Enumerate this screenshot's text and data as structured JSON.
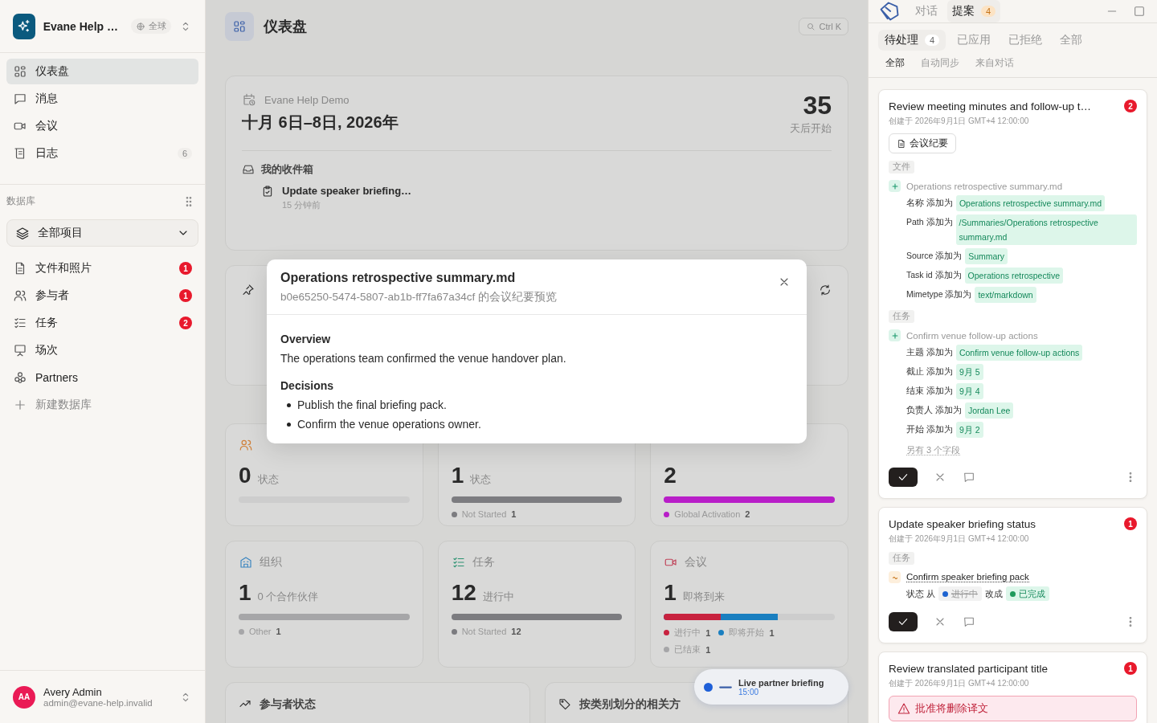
{
  "sidebar": {
    "workspace": {
      "name": "Evane Help …",
      "scope": "全球"
    },
    "nav": [
      {
        "label": "仪表盘",
        "selected": true
      },
      {
        "label": "消息",
        "selected": false
      },
      {
        "label": "会议",
        "selected": false
      },
      {
        "label": "日志",
        "selected": false,
        "count": "6"
      }
    ],
    "section_title": "数据库",
    "database_picker": {
      "label": "全部项目"
    },
    "databases": [
      {
        "label": "文件和照片",
        "badge": "1",
        "selected": false
      },
      {
        "label": "参与者",
        "badge": "1",
        "selected": false
      },
      {
        "label": "任务",
        "badge": "2",
        "selected": false
      },
      {
        "label": "场次",
        "selected": false
      },
      {
        "label": "Partners",
        "selected": false
      }
    ],
    "new_database": "新建数据库",
    "user": {
      "initials": "AA",
      "name": "Avery Admin",
      "email": "admin@evane-help.invalid"
    }
  },
  "header": {
    "title": "仪表盘",
    "shortcut": "Ctrl K"
  },
  "event_card": {
    "name": "Evane Help Demo",
    "dates": "十月 6日–8日, 2026年",
    "countdown": "35",
    "countdown_label": "天后开始",
    "inbox_title": "我的收件箱",
    "inbox_items": [
      {
        "title": "Update speaker briefing…",
        "time": "15 分钟前"
      }
    ]
  },
  "stat_cards": [
    {
      "value": "0",
      "caption": "状态"
    },
    {
      "value": "1",
      "caption": "状态",
      "segments": [
        {
          "color": "#7c7c80",
          "level": 1
        }
      ],
      "legend": [
        {
          "label": "Not Started",
          "count": "1",
          "color": "#7c7c80"
        }
      ]
    },
    {
      "value": "2",
      "segments": [
        {
          "color": "#b81ec8",
          "level": 1
        }
      ],
      "legend": [
        {
          "label": "Global Activation",
          "count": "2",
          "color": "#b81ec8"
        }
      ]
    },
    {
      "title": "组织",
      "value": "1",
      "caption": "0 个合作伙伴",
      "segments": [
        {
          "color": "#a6a6a8",
          "level": 1
        }
      ],
      "legend": [
        {
          "label": "Other",
          "count": "1",
          "color": "#a6a6a8"
        }
      ]
    },
    {
      "title": "任务",
      "value": "12",
      "caption": "进行中",
      "segments": [
        {
          "color": "#7c7c80",
          "level": 1
        }
      ],
      "legend": [
        {
          "label": "Not Started",
          "count": "12",
          "color": "#7c7c80"
        }
      ]
    },
    {
      "title": "会议",
      "value": "1",
      "caption": "即将到来",
      "segments": [
        {
          "color": "#c8223f",
          "level": 0.333
        },
        {
          "color": "#1a7fc0",
          "level": 0.667
        }
      ],
      "legend": [
        {
          "label": "进行中",
          "count": "1",
          "color": "#c8223f"
        },
        {
          "label": "即将开始",
          "count": "1",
          "color": "#1a7fc0"
        },
        {
          "label": "已结束",
          "count": "1",
          "color": "#a6a6a8"
        }
      ]
    }
  ],
  "panels": [
    {
      "title": "参与者状态"
    },
    {
      "title": "按类别划分的相关方"
    }
  ],
  "toast": {
    "title": "Live partner briefing",
    "time": "15:00"
  },
  "modal": {
    "title": "Operations retrospective summary.md",
    "subtitle": "b0e65250-5474-5807-ab1b-ff7fa67a34cf 的会议纪要预览",
    "sections": [
      {
        "heading": "Overview",
        "paragraph": "The operations team confirmed the venue handover plan."
      },
      {
        "heading": "Decisions",
        "bullets": [
          "Publish the final briefing pack.",
          "Confirm the venue operations owner."
        ]
      }
    ]
  },
  "assistant": {
    "tabs": [
      {
        "label": "对话",
        "selected": false
      },
      {
        "label": "提案",
        "selected": true,
        "count": "4"
      }
    ],
    "status_filters": [
      {
        "label": "待处理",
        "count": "4",
        "selected": true
      },
      {
        "label": "已应用",
        "selected": false
      },
      {
        "label": "已拒绝",
        "selected": false
      },
      {
        "label": "全部",
        "selected": false
      }
    ],
    "source_filters": [
      {
        "label": "全部",
        "selected": true
      },
      {
        "label": "自动同步",
        "selected": false
      },
      {
        "label": "来自对话",
        "selected": false
      }
    ],
    "proposals": [
      {
        "title": "Review meeting minutes and follow-up t…",
        "badge": "2",
        "created": "创建于 2026年9月1日 GMT+4 12:00:00",
        "source_chip": "会议纪要",
        "actions": true,
        "groups": [
          {
            "label": "文件",
            "entities": [
              {
                "kind": "add",
                "name": "Operations retrospective summary.md",
                "fields": [
                  {
                    "kind": "added",
                    "label": "名称",
                    "verb": "添加为",
                    "value": "Operations retrospective summary.md"
                  },
                  {
                    "kind": "added",
                    "label": "Path",
                    "verb": "添加为",
                    "value": "/Summaries/Operations retrospective summary.md"
                  },
                  {
                    "kind": "added",
                    "label": "Source",
                    "verb": "添加为",
                    "value": "Summary"
                  },
                  {
                    "kind": "added",
                    "label": "Task id",
                    "verb": "添加为",
                    "value": "Operations retrospective"
                  },
                  {
                    "kind": "added",
                    "label": "Mimetype",
                    "verb": "添加为",
                    "value": "text/markdown"
                  }
                ]
              }
            ]
          },
          {
            "label": "任务",
            "entities": [
              {
                "kind": "add",
                "name": "Confirm venue follow-up actions",
                "more": "另有 3 个字段",
                "fields": [
                  {
                    "kind": "added",
                    "label": "主题",
                    "verb": "添加为",
                    "value": "Confirm venue follow-up actions"
                  },
                  {
                    "kind": "added",
                    "label": "截止",
                    "verb": "添加为",
                    "value": "9月 5"
                  },
                  {
                    "kind": "added",
                    "label": "结束",
                    "verb": "添加为",
                    "value": "9月 4"
                  },
                  {
                    "kind": "added",
                    "label": "负责人",
                    "verb": "添加为",
                    "value": "Jordan Lee"
                  },
                  {
                    "kind": "added",
                    "label": "开始",
                    "verb": "添加为",
                    "value": "9月 2"
                  }
                ]
              }
            ]
          }
        ]
      },
      {
        "title": "Update speaker briefing status",
        "badge": "1",
        "created": "创建于 2026年9月1日 GMT+4 12:00:00",
        "actions": true,
        "groups": [
          {
            "label": "任务",
            "entities": [
              {
                "kind": "update",
                "name": "Confirm speaker briefing pack",
                "fields": [
                  {
                    "kind": "changed",
                    "label": "状态",
                    "from": "从",
                    "old": {
                      "text": "进行中",
                      "color": "#1e64d0"
                    },
                    "to": "改成",
                    "new": {
                      "text": "已完成",
                      "color": "#1f9a5c"
                    }
                  }
                ]
              }
            ]
          }
        ]
      },
      {
        "title": "Review translated participant title",
        "badge": "1",
        "created": "创建于 2026年9月1日 GMT+4 12:00:00",
        "actions": false,
        "warning": "批准将删除译文"
      }
    ]
  }
}
